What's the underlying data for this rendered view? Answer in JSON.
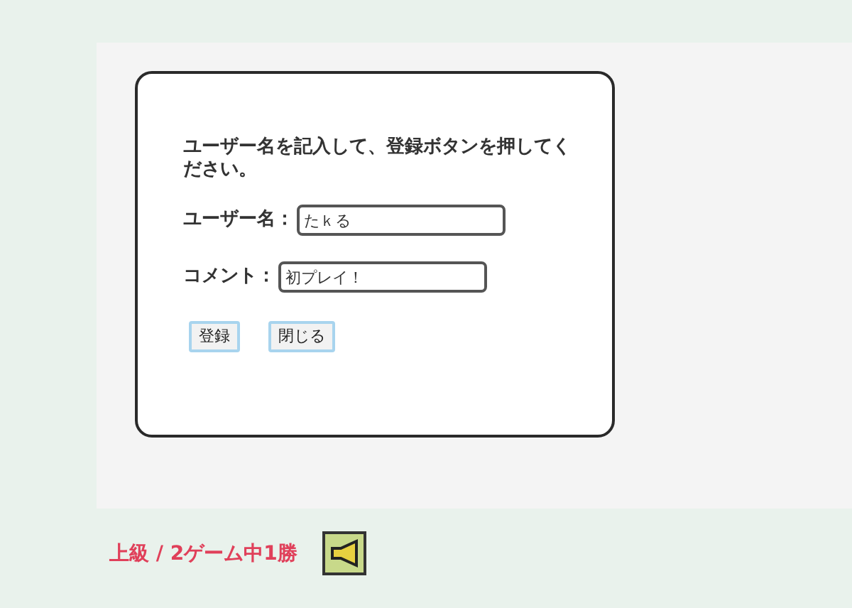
{
  "dialog": {
    "message": "ユーザー名を記入して、登録ボタンを押してください。",
    "fields": [
      {
        "label": "ユーザー名：",
        "value": "たｋる"
      },
      {
        "label": "コメント：",
        "value": "初プレイ！"
      }
    ],
    "buttons": [
      "登録",
      "閉じる"
    ]
  },
  "status": {
    "text": "上級 / 2ゲーム中1勝"
  }
}
